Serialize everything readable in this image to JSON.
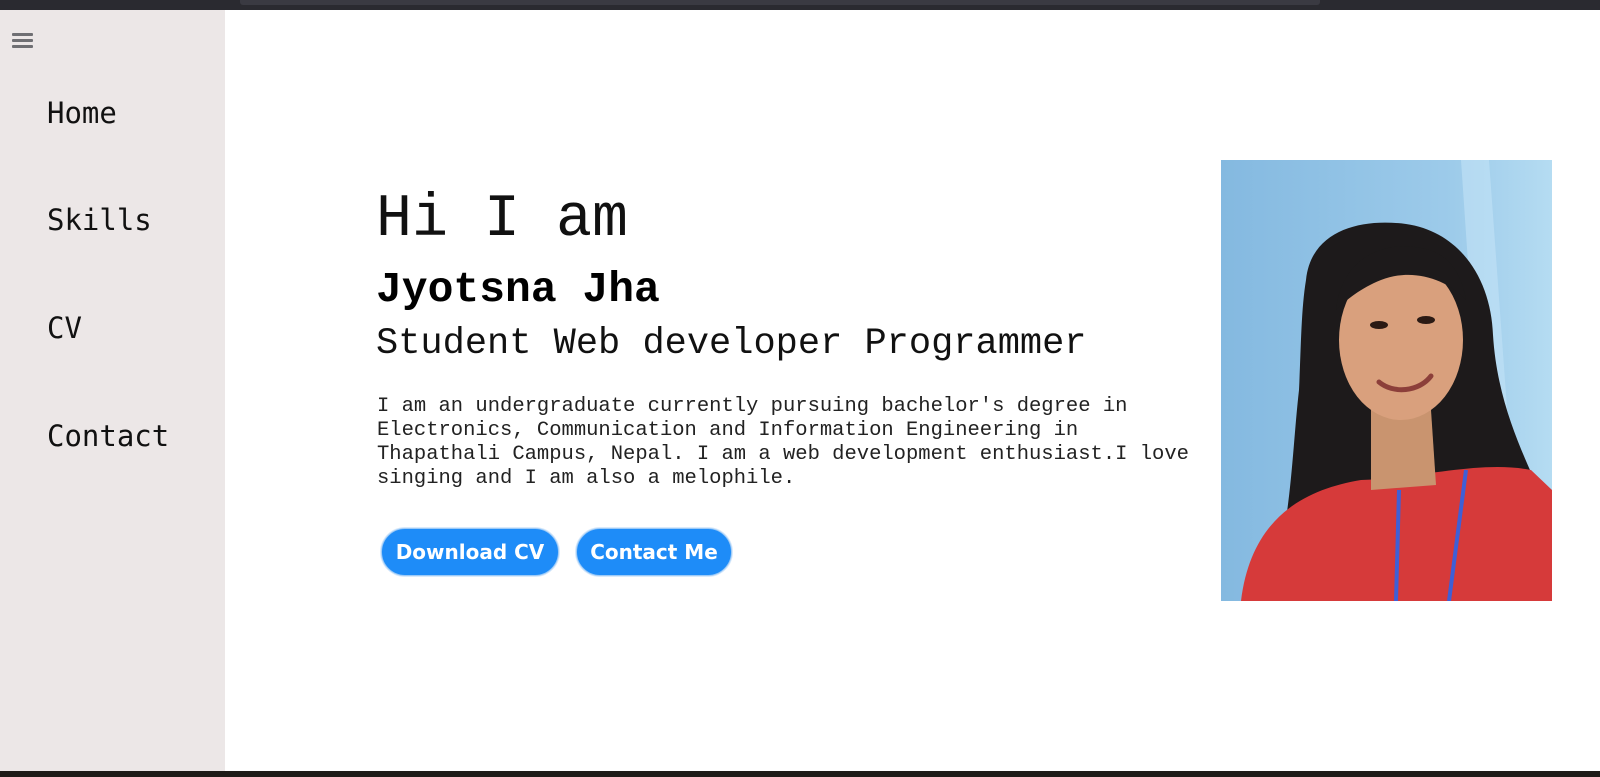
{
  "sidebar": {
    "menu_icon": "hamburger-menu-icon",
    "items": [
      {
        "label": "Home"
      },
      {
        "label": "Skills"
      },
      {
        "label": "CV"
      },
      {
        "label": "Contact"
      }
    ]
  },
  "hero": {
    "greeting": "Hi I am",
    "name": "Jyotsna Jha",
    "role": "Student Web developer Programmer",
    "bio": "I am an undergraduate currently pursuing bachelor's degree in\nElectronics, Communication and Information Engineering in\nThapathali Campus, Nepal. I am a web development enthusiast.I love\nsinging and I am also a melophile.",
    "buttons": {
      "download_cv": "Download CV",
      "contact_me": "Contact Me"
    }
  },
  "colors": {
    "sidebar_bg": "#ece7e7",
    "button_bg": "#1e8cf8",
    "button_text": "#ffffff",
    "page_bg": "#ffffff"
  }
}
